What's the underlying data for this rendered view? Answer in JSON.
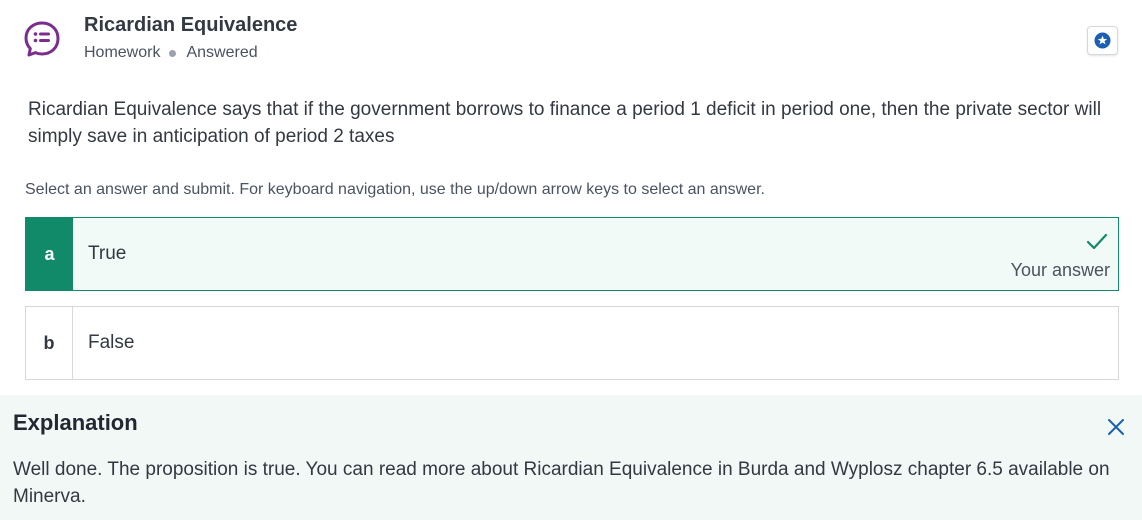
{
  "header": {
    "title": "Ricardian Equivalence",
    "category": "Homework",
    "status": "Answered",
    "icon": "quiz-chat-icon",
    "bookmark_icon": "star-badge-icon",
    "accent_color": "#7b2d8e"
  },
  "question": {
    "text": "Ricardian Equivalence says that if the government borrows to finance a period 1 deficit in period one, then the private sector will simply save in anticipation of period 2 taxes",
    "instructions": "Select an answer and submit. For keyboard navigation, use the up/down arrow keys to select an answer."
  },
  "answers": [
    {
      "letter": "a",
      "label": "True",
      "selected": true,
      "tag": "Your answer"
    },
    {
      "letter": "b",
      "label": "False",
      "selected": false
    }
  ],
  "explanation": {
    "heading": "Explanation",
    "text": "Well done. The proposition is true. You can read more about Ricardian Equivalence in Burda and Wyplosz chapter 6.5 available on Minerva.",
    "close_icon": "close-icon"
  },
  "colors": {
    "correct": "#108a68",
    "explanation_bg": "#f1f8f5",
    "link_blue": "#1a5fb4"
  }
}
